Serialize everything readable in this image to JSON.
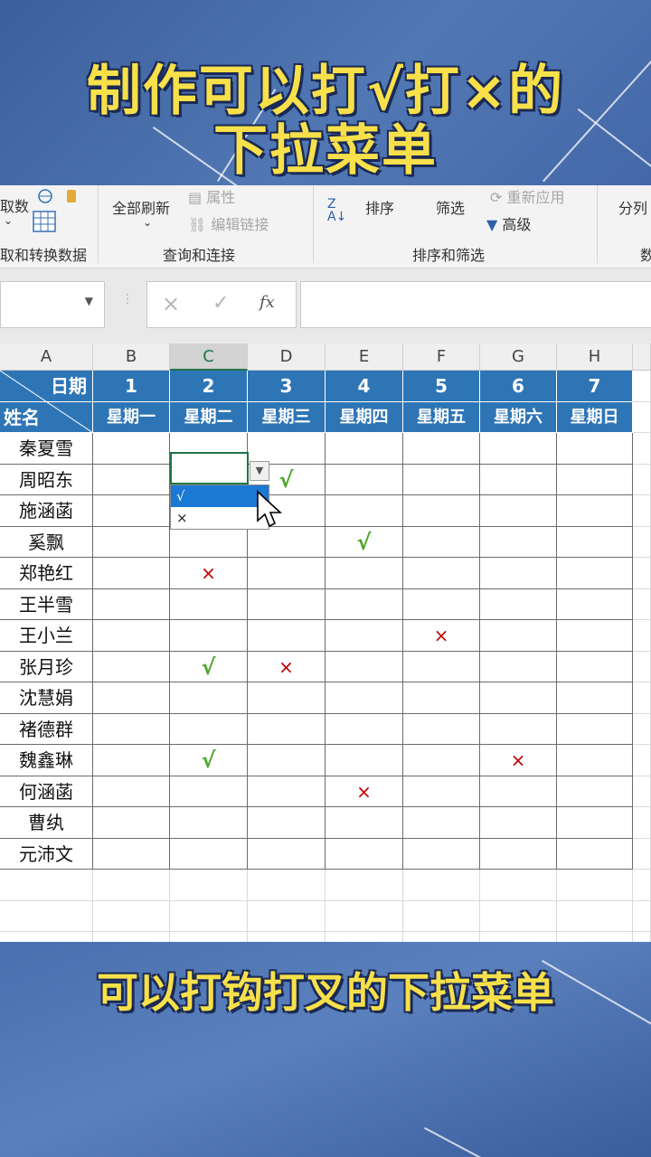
{
  "title": {
    "line1": "制作可以打√打×的",
    "line2": "下拉菜单"
  },
  "subtitle": "可以打钩打叉的下拉菜单",
  "ribbon": {
    "partial_left": "取数",
    "refresh_all": "全部刷新",
    "properties": "属性",
    "edit_links": "编辑链接",
    "sort": "排序",
    "filter": "筛选",
    "reapply": "重新应用",
    "advanced": "高级",
    "split": "分列",
    "group_get_transform": "取和转换数据",
    "group_queries": "查询和连接",
    "group_sort_filter": "排序和筛选",
    "group_partial_right": "数"
  },
  "formula_bar": {
    "cancel": "×",
    "enter": "✓",
    "fx": "fx"
  },
  "sheet": {
    "columns": [
      "A",
      "B",
      "C",
      "D",
      "E",
      "F",
      "G",
      "H"
    ],
    "header_row1": {
      "label": "日期",
      "days": [
        "1",
        "2",
        "3",
        "4",
        "5",
        "6",
        "7"
      ]
    },
    "header_row2": {
      "label": "姓名",
      "weekdays": [
        "星期一",
        "星期二",
        "星期三",
        "星期四",
        "星期五",
        "星期六",
        "星期日"
      ]
    },
    "rows": [
      {
        "name": "秦夏雪",
        "marks": [
          "",
          "",
          "",
          "",
          "",
          "",
          ""
        ]
      },
      {
        "name": "周昭东",
        "marks": [
          "",
          "",
          "√",
          "",
          "",
          "",
          ""
        ]
      },
      {
        "name": "施涵菡",
        "marks": [
          "",
          "",
          "",
          "",
          "",
          "",
          ""
        ]
      },
      {
        "name": "奚飘",
        "marks": [
          "",
          "",
          "",
          "√",
          "",
          "",
          ""
        ]
      },
      {
        "name": "郑艳红",
        "marks": [
          "",
          "×",
          "",
          "",
          "",
          "",
          ""
        ]
      },
      {
        "name": "王半雪",
        "marks": [
          "",
          "",
          "",
          "",
          "",
          "",
          ""
        ]
      },
      {
        "name": "王小兰",
        "marks": [
          "",
          "",
          "",
          "",
          "×",
          "",
          ""
        ]
      },
      {
        "name": "张月珍",
        "marks": [
          "",
          "√",
          "×",
          "",
          "",
          "",
          ""
        ]
      },
      {
        "name": "沈慧娟",
        "marks": [
          "",
          "",
          "",
          "",
          "",
          "",
          ""
        ]
      },
      {
        "name": "褚德群",
        "marks": [
          "",
          "",
          "",
          "",
          "",
          "",
          ""
        ]
      },
      {
        "name": "魏鑫琳",
        "marks": [
          "",
          "√",
          "",
          "",
          "",
          "×",
          ""
        ]
      },
      {
        "name": "何涵菡",
        "marks": [
          "",
          "",
          "",
          "×",
          "",
          "",
          ""
        ]
      },
      {
        "name": "曹纨",
        "marks": [
          "",
          "",
          "",
          "",
          "",
          "",
          ""
        ]
      },
      {
        "name": "元沛文",
        "marks": [
          "",
          "",
          "",
          "",
          "",
          "",
          ""
        ]
      }
    ],
    "dropdown": {
      "options": [
        "√",
        "×"
      ],
      "highlighted": 0
    }
  },
  "colors": {
    "header_blue": "#2e75b6",
    "check_green": "#4ea72e",
    "cross_red": "#c00000",
    "title_yellow": "#f7e04a"
  }
}
